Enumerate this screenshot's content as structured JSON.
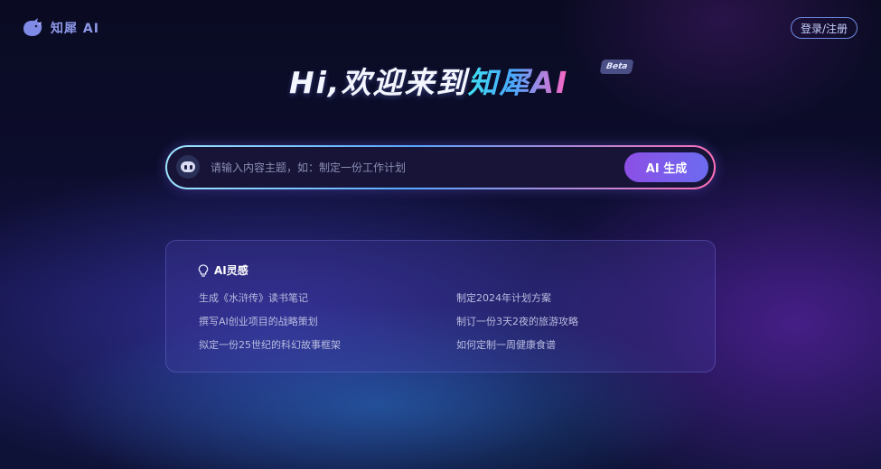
{
  "header": {
    "logo_icon": "rhino-logo-icon",
    "logo_text": "知犀 AI",
    "login_label": "登录/注册"
  },
  "hero": {
    "greeting": "Hi,欢迎来到",
    "brand": "知犀AI",
    "badge": "Beta"
  },
  "search": {
    "icon": "robot-icon",
    "placeholder": "请输入内容主题，如：制定一份工作计划",
    "value": "",
    "button_label": "AI 生成"
  },
  "inspiration": {
    "icon": "lightbulb-icon",
    "title": "AI灵感",
    "items": [
      "生成《水浒传》读书笔记",
      "制定2024年计划方案",
      "撰写AI创业项目的战略策划",
      "制订一份3天2夜的旅游攻略",
      "拟定一份25世纪的科幻故事框架",
      "如何定制一周健康食谱"
    ]
  },
  "colors": {
    "background": "#0c0d2c",
    "accent_cyan": "#3fe0f0",
    "accent_pink": "#ff63c3",
    "button_purple": "#8c4fe6"
  }
}
